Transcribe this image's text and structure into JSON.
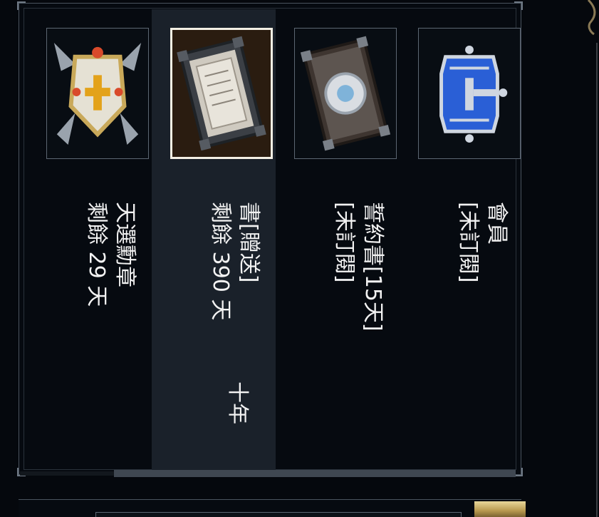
{
  "items": [
    {
      "icon": "shield-emblem-icon",
      "title": "天選勳章",
      "subtitle": "剩餘 29 天",
      "extra": "",
      "selected": false
    },
    {
      "icon": "stone-tablet-book-icon",
      "title": "書[贈送]",
      "subtitle": "剩餘 390 天",
      "extra": "十年",
      "selected": true
    },
    {
      "icon": "contract-book-icon",
      "title": "誓約書[15天]",
      "subtitle": "[未訂閱]",
      "extra": "",
      "selected": false
    },
    {
      "icon": "blue-crown-icon",
      "title": "會員",
      "subtitle": "[未訂閱]",
      "extra": "",
      "selected": false
    }
  ],
  "colors": {
    "background": "#05080d",
    "selected_column": "#1a212a",
    "text": "#f2f2f2",
    "gold": "#c9a95a",
    "crown_blue": "#2a5fd6"
  }
}
